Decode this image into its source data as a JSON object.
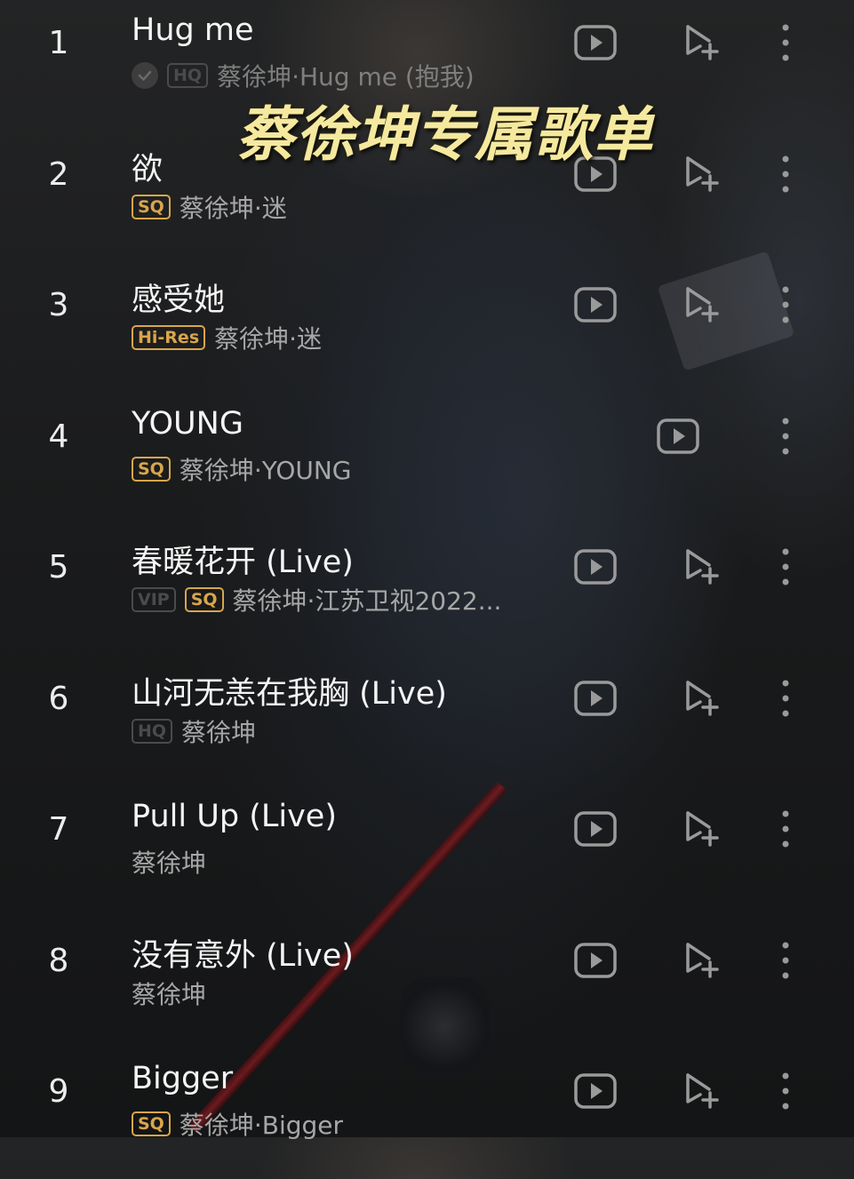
{
  "overlay_title": "蔡徐坤专属歌单",
  "songs": [
    {
      "num": "1",
      "title": "Hug me",
      "badges": [
        "HQ"
      ],
      "artist_line": "蔡徐坤·Hug me (抱我)",
      "check": true,
      "has_add": true
    },
    {
      "num": "2",
      "title": "欲",
      "badges": [
        "SQ"
      ],
      "artist_line": "蔡徐坤·迷",
      "check": false,
      "has_add": true
    },
    {
      "num": "3",
      "title": "感受她",
      "badges": [
        "Hi-Res"
      ],
      "artist_line": "蔡徐坤·迷",
      "check": false,
      "has_add": true
    },
    {
      "num": "4",
      "title": "YOUNG",
      "badges": [
        "SQ"
      ],
      "artist_line": "蔡徐坤·YOUNG",
      "check": false,
      "has_add": false
    },
    {
      "num": "5",
      "title": "春暖花开 (Live)",
      "badges": [
        "VIP",
        "SQ"
      ],
      "artist_line": "蔡徐坤·江苏卫视2022...",
      "check": false,
      "has_add": true
    },
    {
      "num": "6",
      "title": "山河无恙在我胸 (Live)",
      "badges": [
        "HQ"
      ],
      "artist_line": "蔡徐坤",
      "check": false,
      "has_add": true
    },
    {
      "num": "7",
      "title": "Pull Up (Live)",
      "badges": [],
      "artist_line": "蔡徐坤",
      "check": false,
      "has_add": true
    },
    {
      "num": "8",
      "title": "没有意外 (Live)",
      "badges": [],
      "artist_line": "蔡徐坤",
      "check": false,
      "has_add": true
    },
    {
      "num": "9",
      "title": "Bigger",
      "badges": [
        "SQ"
      ],
      "artist_line": "蔡徐坤·Bigger",
      "check": false,
      "has_add": true
    }
  ],
  "icons": {
    "play": "video-play-icon",
    "add": "add-to-playlist-icon",
    "more": "more-vertical-icon",
    "check": "downloaded-check-icon"
  },
  "colors": {
    "badge_gold": "#d8a64b",
    "badge_gray": "#4b4b4b",
    "title_yellow": "#f5e9a0"
  }
}
